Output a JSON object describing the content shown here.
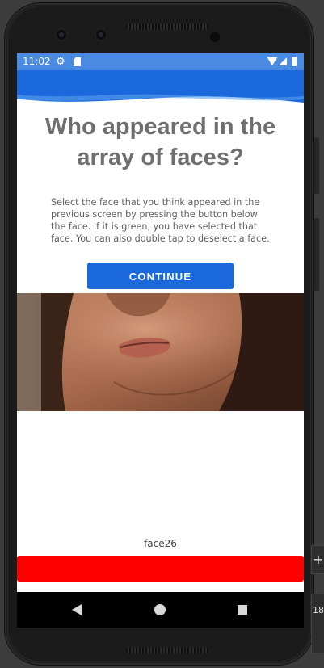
{
  "status_bar": {
    "time": "11:02",
    "icons": [
      "settings-gear-icon",
      "sd-card-icon",
      "wifi-icon",
      "cell-signal-icon",
      "battery-icon"
    ],
    "background": "#4a8ae0"
  },
  "screen": {
    "title": "Who appeared in the array of faces?",
    "instructions": "Select the face that you think appeared in the previous screen by pressing the button below the face. If it is green, you have selected that face. You can also double tap to deselect a face.",
    "continue_label": "CONTINUE",
    "face_label": "face26",
    "select_button_color": "#ff0000",
    "accent_color": "#1a68dc"
  },
  "nav_bar": {
    "icons": [
      "back-icon",
      "home-icon",
      "recents-icon"
    ]
  },
  "emulator_side": {
    "plus_glyph": "+",
    "partial_text": "18"
  }
}
